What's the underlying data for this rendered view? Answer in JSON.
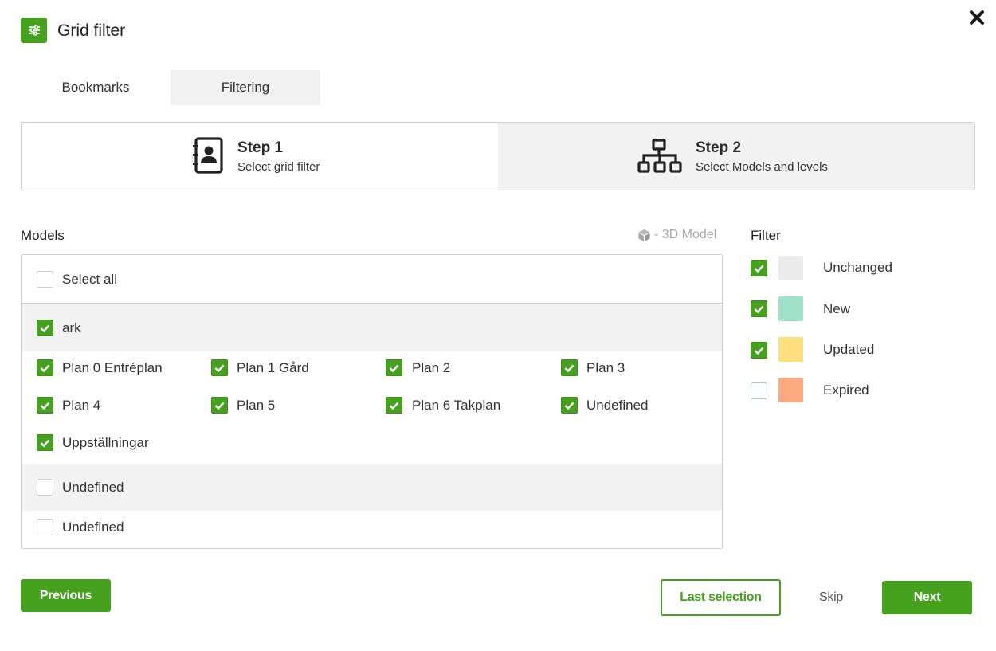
{
  "header": {
    "title": "Grid filter",
    "icon": "sliders-icon"
  },
  "tabs": [
    {
      "label": "Bookmarks"
    },
    {
      "label": "Filtering",
      "active": true
    }
  ],
  "steps": [
    {
      "title": "Step 1",
      "subtitle": "Select grid filter",
      "icon": "contact-book-icon"
    },
    {
      "title": "Step 2",
      "subtitle": "Select Models and levels",
      "icon": "hierarchy-icon",
      "active": true
    }
  ],
  "models": {
    "label": "Models",
    "legend": "- 3D Model",
    "select_all": {
      "label": "Select all",
      "checked": false
    },
    "groups": [
      {
        "name": "ark",
        "checked": true,
        "levels": [
          {
            "label": "Plan 0 Entréplan",
            "checked": true
          },
          {
            "label": "Plan 1 Gård",
            "checked": true
          },
          {
            "label": "Plan 2",
            "checked": true
          },
          {
            "label": "Plan 3",
            "checked": true
          },
          {
            "label": "Plan 4",
            "checked": true
          },
          {
            "label": "Plan 5",
            "checked": true
          },
          {
            "label": "Plan 6 Takplan",
            "checked": true
          },
          {
            "label": "Undefined",
            "checked": true
          },
          {
            "label": "Uppställningar",
            "checked": true
          }
        ]
      },
      {
        "name": "Undefined",
        "checked": false,
        "levels": [
          {
            "label": "Undefined",
            "checked": false
          }
        ]
      }
    ]
  },
  "filter": {
    "label": "Filter",
    "items": [
      {
        "label": "Unchanged",
        "checked": true,
        "color": "#ebebeb"
      },
      {
        "label": "New",
        "checked": true,
        "color": "#9fe2c8"
      },
      {
        "label": "Updated",
        "checked": true,
        "color": "#fedf80"
      },
      {
        "label": "Expired",
        "checked": false,
        "color": "#fdaa80"
      }
    ]
  },
  "footer": {
    "previous": "Previous",
    "last_selection": "Last selection",
    "skip": "Skip",
    "next": "Next"
  },
  "colors": {
    "accent": "#46a21e",
    "panel_gray": "#f2f2f3"
  }
}
